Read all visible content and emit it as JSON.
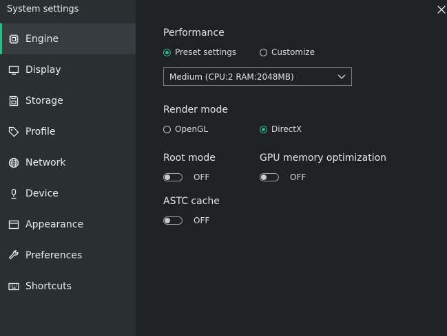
{
  "window": {
    "title": "System settings",
    "close_icon": "close-icon"
  },
  "sidebar": {
    "active_color": "#2fb88a",
    "items": [
      {
        "label": "Engine",
        "icon": "chip-icon",
        "active": true
      },
      {
        "label": "Display",
        "icon": "monitor-icon"
      },
      {
        "label": "Storage",
        "icon": "disk-icon"
      },
      {
        "label": "Profile",
        "icon": "tag-icon"
      },
      {
        "label": "Network",
        "icon": "globe-icon"
      },
      {
        "label": "Device",
        "icon": "microphone-icon"
      },
      {
        "label": "Appearance",
        "icon": "window-icon"
      },
      {
        "label": "Preferences",
        "icon": "wrench-icon"
      },
      {
        "label": "Shortcuts",
        "icon": "keyboard-icon"
      }
    ]
  },
  "performance": {
    "title": "Performance",
    "options": [
      "Preset settings",
      "Customize"
    ],
    "selected": "Preset settings",
    "preset_value": "Medium (CPU:2 RAM:2048MB)"
  },
  "render_mode": {
    "title": "Render mode",
    "options": [
      "OpenGL",
      "DirectX"
    ],
    "selected": "DirectX"
  },
  "root_mode": {
    "title": "Root mode",
    "state": "OFF"
  },
  "gpu_memory": {
    "title": "GPU memory optimization",
    "state": "OFF"
  },
  "astc_cache": {
    "title": "ASTC cache",
    "state": "OFF"
  }
}
